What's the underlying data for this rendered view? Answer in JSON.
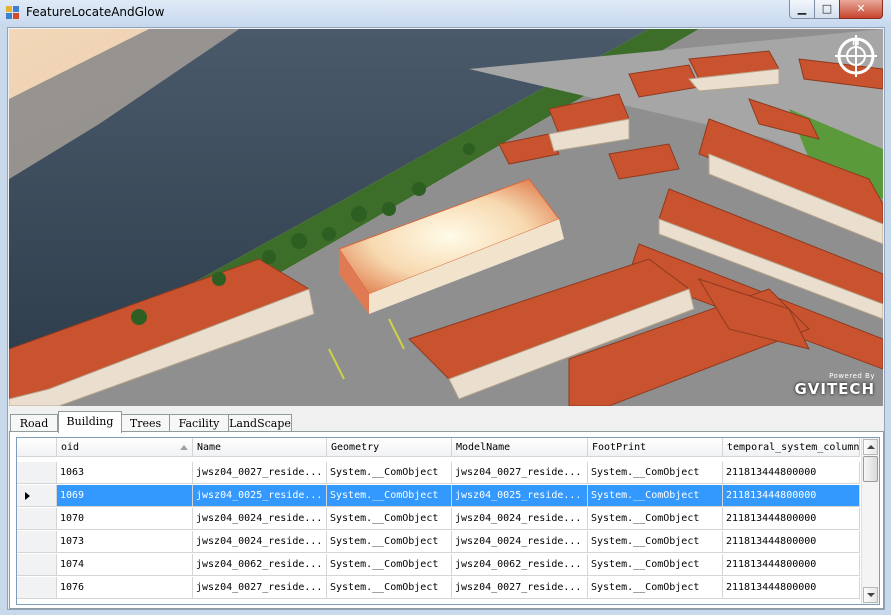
{
  "window": {
    "title": "FeatureLocateAndGlow",
    "minimize_glyph": "▁",
    "maximize_glyph": "□",
    "close_glyph": "✕"
  },
  "viewport": {
    "logo_small": "Powered By",
    "logo": "GVITECH",
    "compass_letter": "N"
  },
  "tabs": [
    {
      "label": "Road"
    },
    {
      "label": "Building"
    },
    {
      "label": "Trees"
    },
    {
      "label": "Facility"
    },
    {
      "label": "LandScape"
    }
  ],
  "active_tab": "Building",
  "grid": {
    "columns": [
      "oid",
      "Name",
      "Geometry",
      "ModelName",
      "FootPrint",
      "temporal_system_column"
    ],
    "sorted_column": "oid",
    "selected_row_index": 1,
    "rows": [
      [
        "1063",
        "jwsz04_0027_reside...",
        "System.__ComObject",
        "jwsz04_0027_reside...",
        "System.__ComObject",
        "211813444800000"
      ],
      [
        "1069",
        "jwsz04_0025_reside...",
        "System.__ComObject",
        "jwsz04_0025_reside...",
        "System.__ComObject",
        "211813444800000"
      ],
      [
        "1070",
        "jwsz04_0024_reside...",
        "System.__ComObject",
        "jwsz04_0024_reside...",
        "System.__ComObject",
        "211813444800000"
      ],
      [
        "1073",
        "jwsz04_0024_reside...",
        "System.__ComObject",
        "jwsz04_0024_reside...",
        "System.__ComObject",
        "211813444800000"
      ],
      [
        "1074",
        "jwsz04_0062_reside...",
        "System.__ComObject",
        "jwsz04_0062_reside...",
        "System.__ComObject",
        "211813444800000"
      ],
      [
        "1076",
        "jwsz04_0027_reside...",
        "System.__ComObject",
        "jwsz04_0027_reside...",
        "System.__ComObject",
        "211813444800000"
      ]
    ]
  },
  "colors": {
    "selection": "#3399ff",
    "roof": "#c9532f",
    "water": "#3a4b5c",
    "grass": "#4f8a2b",
    "sand": "#e8c7a3"
  }
}
